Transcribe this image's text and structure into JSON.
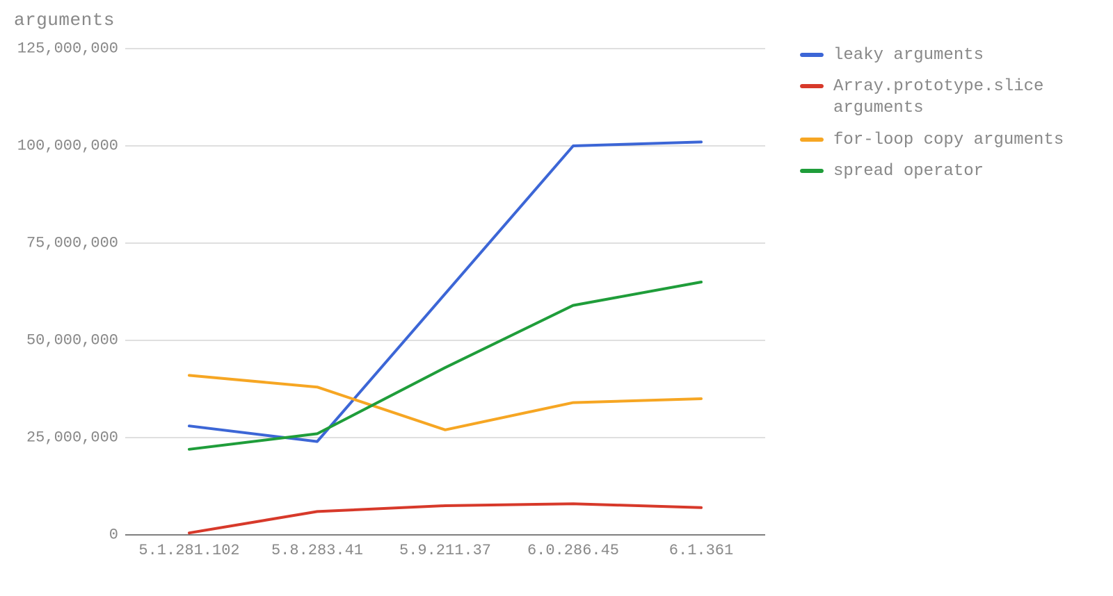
{
  "chart_data": {
    "type": "line",
    "title": "arguments",
    "xlabel": "",
    "ylabel": "",
    "ylim": [
      0,
      125000000
    ],
    "y_ticks": [
      0,
      25000000,
      50000000,
      75000000,
      100000000,
      125000000
    ],
    "y_tick_labels": [
      "0",
      "25,000,000",
      "50,000,000",
      "75,000,000",
      "100,000,000",
      "125,000,000"
    ],
    "categories": [
      "5.1.281.102",
      "5.8.283.41",
      "5.9.211.37",
      "6.0.286.45",
      "6.1.361"
    ],
    "series": [
      {
        "name": "leaky arguments",
        "color": "#3c66d6",
        "values": [
          28000000,
          24000000,
          62000000,
          100000000,
          101000000
        ]
      },
      {
        "name": "Array.prototype.slice arguments",
        "color": "#d7392a",
        "values": [
          500000,
          6000000,
          7500000,
          8000000,
          7000000
        ]
      },
      {
        "name": "for-loop copy arguments",
        "color": "#f6a623",
        "values": [
          41000000,
          38000000,
          27000000,
          34000000,
          35000000
        ]
      },
      {
        "name": "spread operator",
        "color": "#1f9d3a",
        "values": [
          22000000,
          26000000,
          43000000,
          59000000,
          65000000
        ]
      }
    ],
    "grid": true,
    "legend_position": "right"
  }
}
